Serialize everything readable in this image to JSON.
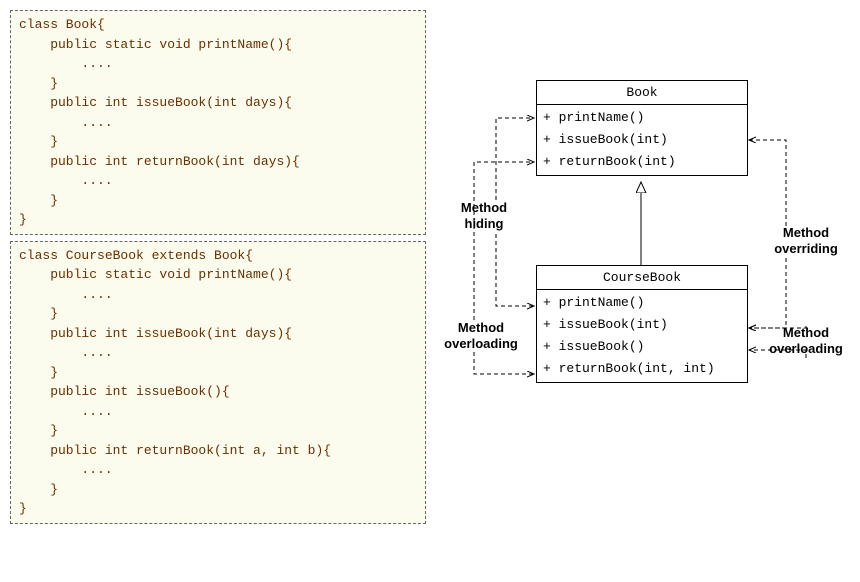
{
  "code": {
    "book": "class Book{\n    public static void printName(){\n        ....\n    }\n    public int issueBook(int days){\n        ....\n    }\n    public int returnBook(int days){\n        ....\n    }\n}",
    "courseBook": "class CourseBook extends Book{\n    public static void printName(){\n        ....\n    }\n    public int issueBook(int days){\n        ....\n    }\n    public int issueBook(){\n        ....\n    }\n    public int returnBook(int a, int b){\n        ....\n    }\n}"
  },
  "uml": {
    "book": {
      "title": "Book",
      "methods": [
        "+ printName()",
        "+ issueBook(int)",
        "+ returnBook(int)"
      ]
    },
    "courseBook": {
      "title": "CourseBook",
      "methods": [
        "+ printName()",
        "+ issueBook(int)",
        "+ issueBook()",
        "+ returnBook(int, int)"
      ]
    }
  },
  "labels": {
    "hiding": "Method\nhiding",
    "overriding": "Method\noverriding",
    "overloading1": "Method\noverloading",
    "overloading2": "Method\noverloading"
  }
}
